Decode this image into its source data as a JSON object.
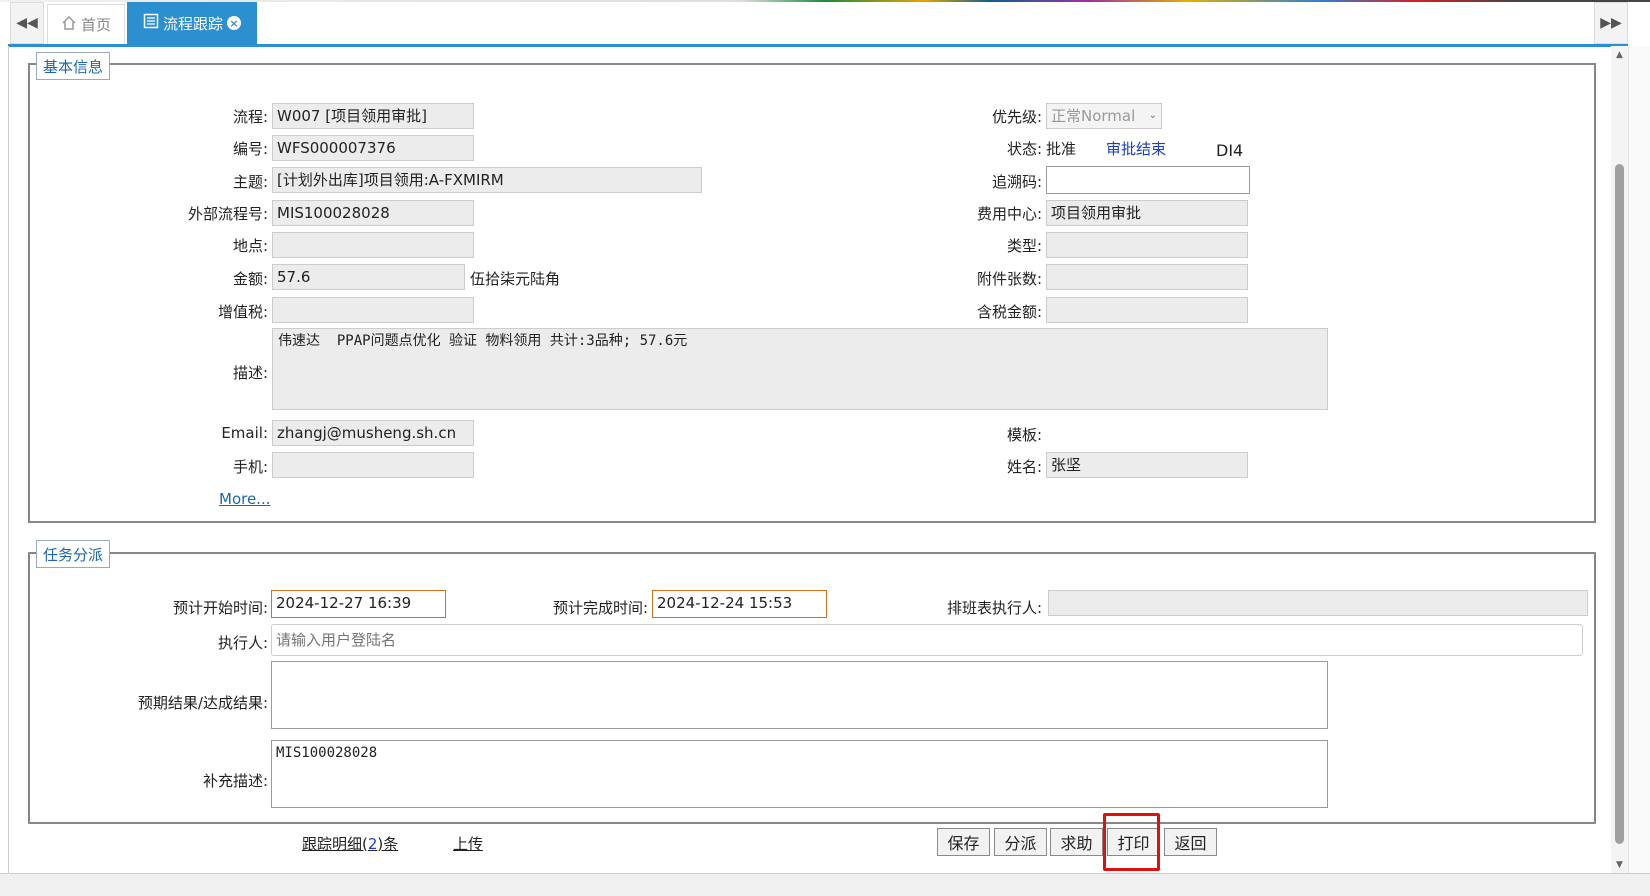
{
  "tabs": {
    "home_label": "首页",
    "active_label": "流程跟踪"
  },
  "basic": {
    "legend": "基本信息",
    "flow_label": "流程:",
    "flow_value": "W007 [项目领用审批]",
    "number_label": "编号:",
    "number_value": "WFS000007376",
    "subject_label": "主题:",
    "subject_value": "[计划外出库]项目领用:A-FXMIRM",
    "extno_label": "外部流程号:",
    "extno_value": "MIS100028028",
    "location_label": "地点:",
    "location_value": "",
    "amount_label": "金额:",
    "amount_value": "57.6",
    "amount_words": "伍拾柒元陆角",
    "vat_label": "增值税:",
    "vat_value": "",
    "desc_label": "描述:",
    "desc_value": "伟速达  PPAP问题点优化 验证 物料领用 共计:3品种; 57.6元",
    "email_label": "Email:",
    "email_value": "zhangj@musheng.sh.cn",
    "mobile_label": "手机:",
    "mobile_value": "",
    "more_link": "More...",
    "priority_label": "优先级:",
    "priority_value": "正常Normal",
    "status_label": "状态:",
    "status_value": "批准",
    "status_link": "审批结束",
    "status_extra": "DI4",
    "trace_label": "追溯码:",
    "trace_value": "",
    "costcenter_label": "费用中心:",
    "costcenter_value": "项目领用审批",
    "type_label": "类型:",
    "type_value": "",
    "attach_label": "附件张数:",
    "attach_value": "",
    "taxamount_label": "含税金额:",
    "taxamount_value": "",
    "template_label": "模板:",
    "name_label": "姓名:",
    "name_value": "张坚"
  },
  "task": {
    "legend": "任务分派",
    "start_label": "预计开始时间:",
    "start_value": "2024-12-27 16:39",
    "end_label": "预计完成时间:",
    "end_value": "2024-12-24 15:53",
    "schedule_label": "排班表执行人:",
    "schedule_value": "",
    "executor_label": "执行人:",
    "executor_placeholder": "请输入用户登陆名",
    "expected_label": "预期结果/达成结果:",
    "expected_value": "",
    "extra_label": "补充描述:",
    "extra_value": "MIS100028028"
  },
  "footer": {
    "trace_detail_prefix": "跟踪明细(",
    "trace_detail_count": "2",
    "trace_detail_suffix": ")条",
    "upload": "上传",
    "save": "保存",
    "assign": "分派",
    "help": "求助",
    "print": "打印",
    "back": "返回"
  },
  "colors": {
    "accent": "#2b8fd0",
    "link": "#1a66b5",
    "highlight": "#e01010",
    "orange_border": "#d07020"
  }
}
